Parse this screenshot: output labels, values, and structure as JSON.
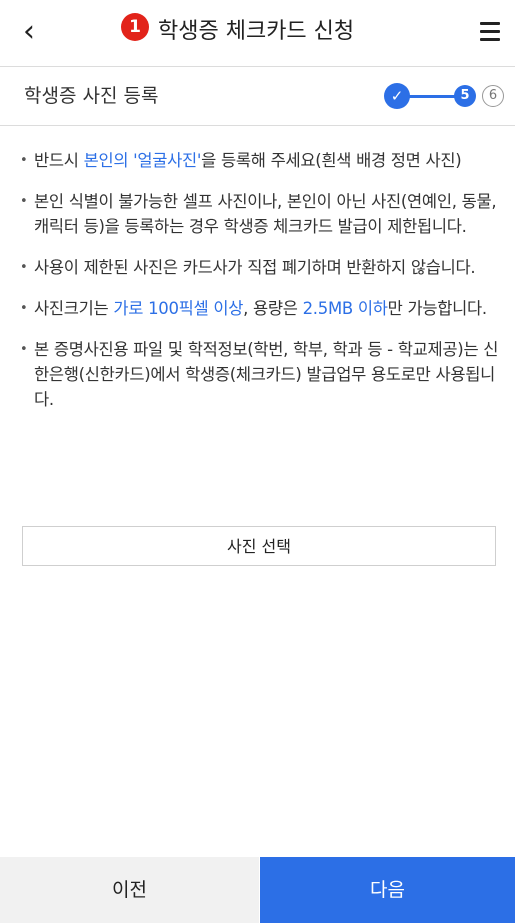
{
  "header": {
    "back_glyph": "‹",
    "step_badge": "1",
    "title": "학생증 체크카드 신청",
    "menu_icon": "hamburger-menu-icon"
  },
  "subheader": {
    "title": "학생증 사진 등록",
    "steps": {
      "done_mark": "✓",
      "current": "5",
      "next": "6"
    }
  },
  "notes": [
    {
      "parts": [
        "반드시 ",
        "본인의 '얼굴사진'",
        "을 등록해 주세요(흰색 배경 정면 사진)"
      ]
    },
    {
      "parts": [
        "본인 식별이 불가능한 셀프 사진이나, 본인이 아닌 사진(연예인, 동물, 캐릭터 등)을 등록하는 경우 학생증 체크카드 발급이 제한됩니다."
      ]
    },
    {
      "parts": [
        "사용이 제한된 사진은 카드사가 직접 폐기하며 반환하지 않습니다."
      ]
    },
    {
      "parts": [
        "사진크기는 ",
        "가로 100픽셀 이상",
        ", 용량은 ",
        "2.5MB 이하",
        "만 가능합니다."
      ]
    },
    {
      "parts": [
        "본 증명사진용 파일 및 학적정보(학번, 학부, 학과 등 - 학교제공)는 신한은행(신한카드)에서 학생증(체크카드) 발급업무 용도로만 사용됩니다."
      ]
    }
  ],
  "photo_button": "사진 선택",
  "footer": {
    "prev": "이전",
    "next": "다음"
  },
  "colors": {
    "accent": "#2c6fe6",
    "badge": "#e2231a"
  }
}
